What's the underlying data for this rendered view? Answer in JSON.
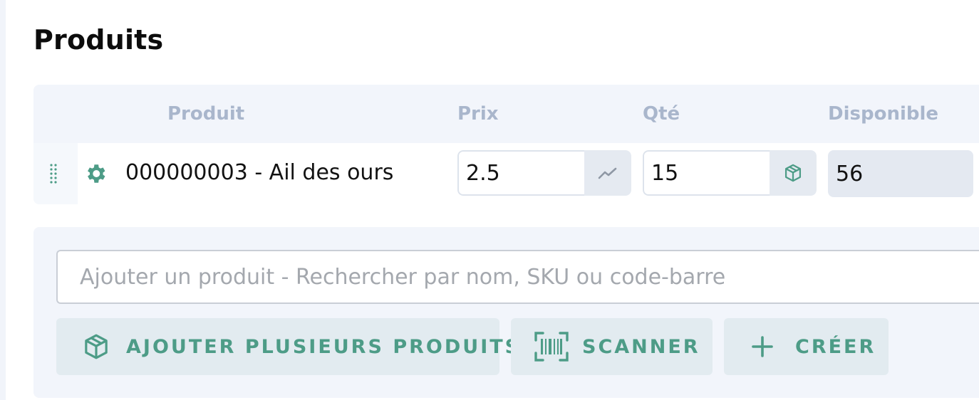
{
  "section": {
    "title": "Produits"
  },
  "table": {
    "headers": {
      "product": "Produit",
      "price": "Prix",
      "qty": "Qté",
      "available": "Disponible"
    },
    "rows": [
      {
        "product": "000000003 - Ail des ours",
        "price": "2.5",
        "qty": "15",
        "available": "56"
      }
    ]
  },
  "add_panel": {
    "search_placeholder": "Ajouter un produit - Rechercher par nom, SKU ou code-barre",
    "buttons": {
      "add_multiple": "AJOUTER PLUSIEURS PRODUITS",
      "scan": "SCANNER",
      "create": "CRÉER"
    }
  },
  "icons": {
    "drag": "drag-handle-icon",
    "settings": "gear-icon",
    "price_history": "trend-chart-icon",
    "stock": "box-icon",
    "add_multiple": "box-icon",
    "scan": "barcode-icon",
    "create": "plus-icon"
  },
  "colors": {
    "accent": "#4d9c87",
    "header_text": "#a9b6cc",
    "panel_bg": "#f2f5fb",
    "button_bg": "#e2ebf0"
  }
}
